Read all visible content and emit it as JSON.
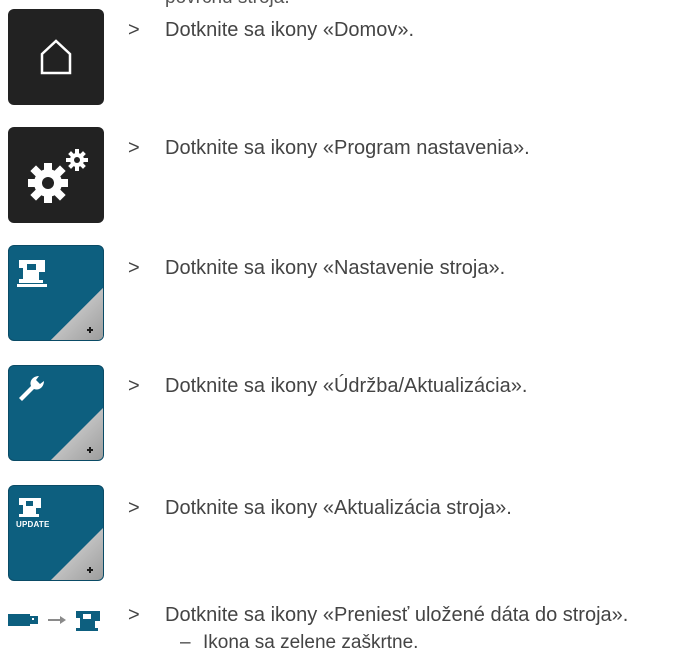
{
  "top_partial_text": "povrchu stroja.",
  "arrow_symbol": ">",
  "dash_symbol": "–",
  "steps": [
    {
      "icon": "home-icon",
      "text": "Dotknite sa ikony «Domov»."
    },
    {
      "icon": "gears-icon",
      "text": "Dotknite sa ikony «Program nastavenia»."
    },
    {
      "icon": "sewing-machine-icon",
      "text": "Dotknite sa ikony «Nastavenie stroja»."
    },
    {
      "icon": "wrench-icon",
      "text": "Dotknite sa ikony «Údržba/Aktualizácia»."
    },
    {
      "icon": "machine-update-icon",
      "icon_label": "UPDATE",
      "text": "Dotknite sa ikony «Aktualizácia stroja»."
    },
    {
      "icon": "usb-to-machine-icon",
      "text": "Dotknite sa ikony «Preniesť uložené dáta do stroja»."
    }
  ],
  "result_text": "Ikona sa zelene zaškrtne.",
  "colors": {
    "dark_tile": "#222222",
    "blue_tile": "#0d5f7f",
    "arrow_gray": "#8a8a8a"
  }
}
